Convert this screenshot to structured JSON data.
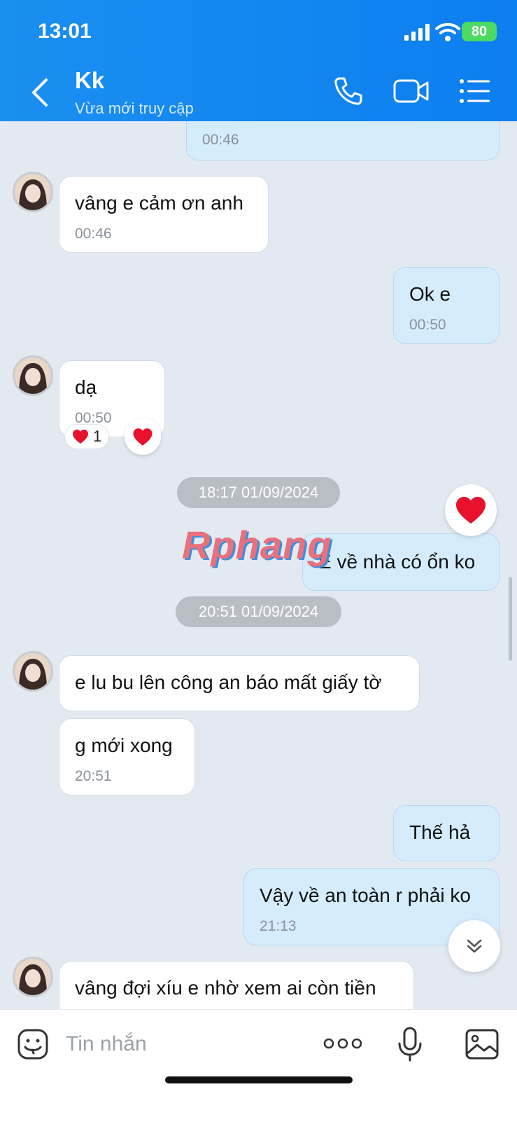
{
  "status_bar": {
    "time": "13:01",
    "battery": "80"
  },
  "header": {
    "title": "Kk",
    "subtitle": "Vừa mới truy cập"
  },
  "messages": [
    {
      "dir": "out",
      "time": "00:46"
    },
    {
      "dir": "in",
      "text": "vâng e cảm ơn anh",
      "time": "00:46"
    },
    {
      "dir": "out",
      "text": "Ok e",
      "time": "00:50"
    },
    {
      "dir": "in",
      "text": "dạ",
      "time": "00:50",
      "reaction_count": "1"
    },
    {
      "dir": "out",
      "text": "E về nhà có ổn ko"
    },
    {
      "dir": "in",
      "text": "e lu bu lên công an báo mất giấy tờ"
    },
    {
      "dir": "in",
      "text": "g mới xong",
      "time": "20:51"
    },
    {
      "dir": "out",
      "text": "Thế hả"
    },
    {
      "dir": "out",
      "text": "Vậy về an toàn r phải ko",
      "time": "21:13"
    },
    {
      "dir": "in",
      "text": "vâng đợi xíu e nhờ xem ai còn tiền"
    }
  ],
  "date_separators": [
    "18:17 01/09/2024",
    "20:51 01/09/2024"
  ],
  "watermark": "Rphang",
  "input": {
    "placeholder": "Tin nhắn"
  },
  "icons": {
    "back": "chevron-left-icon",
    "call": "phone-icon",
    "video": "video-camera-icon",
    "menu": "list-icon",
    "emoji": "sticker-icon",
    "more": "more-dots-icon",
    "mic": "microphone-icon",
    "image": "image-icon",
    "heart": "heart-icon",
    "scroll_down": "double-chevron-down-icon"
  },
  "colors": {
    "header": "#0d7ef0",
    "outgoing": "#d5ecfd",
    "incoming": "#ffffff",
    "background": "#e2e9f1",
    "heart": "#e8112d"
  }
}
